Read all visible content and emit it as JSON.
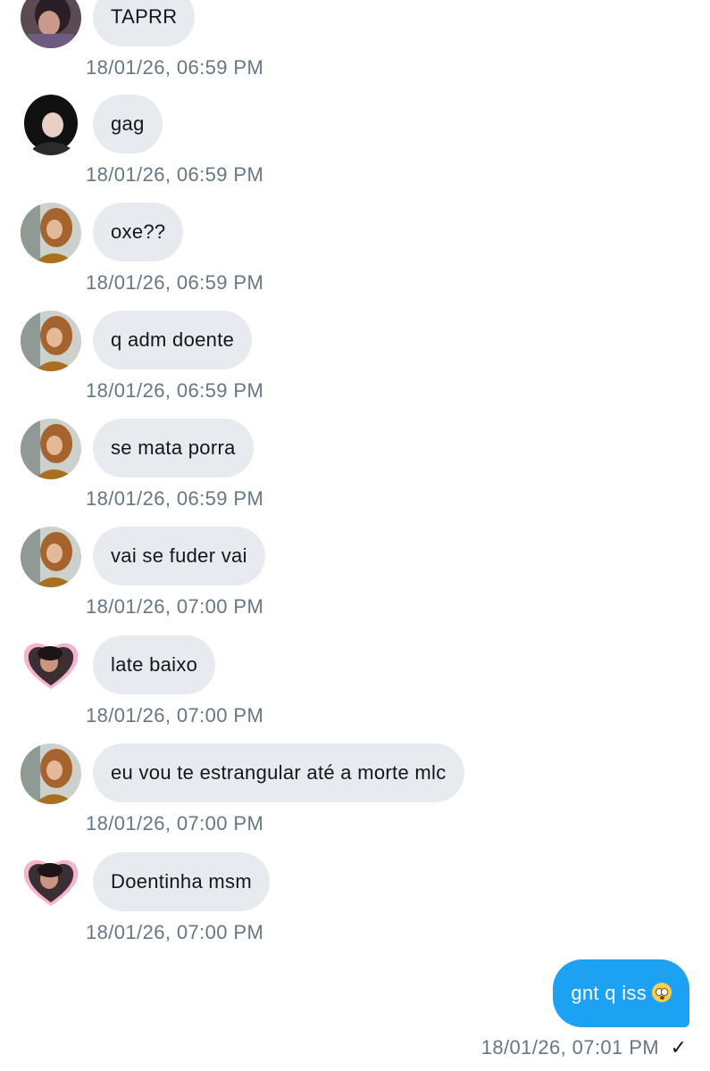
{
  "messages": [
    {
      "text": "TAPRR",
      "time": "18/01/26, 06:59 PM",
      "avatar": "avatar-b"
    },
    {
      "text": "gag",
      "time": "18/01/26, 06:59 PM",
      "avatar": "avatar-c"
    },
    {
      "text": "oxe??",
      "time": "18/01/26, 06:59 PM",
      "avatar": "avatar-a"
    },
    {
      "text": "q adm doente",
      "time": "18/01/26, 06:59 PM",
      "avatar": "avatar-a"
    },
    {
      "text": "se mata porra",
      "time": "18/01/26, 06:59 PM",
      "avatar": "avatar-a"
    },
    {
      "text": "vai se fuder vai",
      "time": "18/01/26, 07:00 PM",
      "avatar": "avatar-a"
    },
    {
      "text": "late baixo",
      "time": "18/01/26, 07:00 PM",
      "avatar": "avatar-heart"
    },
    {
      "text": "eu vou te estrangular até a morte mlc",
      "time": "18/01/26, 07:00 PM",
      "avatar": "avatar-a"
    },
    {
      "text": "Doentinha msm",
      "time": "18/01/26, 07:00 PM",
      "avatar": "avatar-heart"
    }
  ],
  "outgoing": {
    "text": "gnt q iss",
    "emoji": "flushed-face-emoji",
    "time": "18/01/26, 07:01 PM",
    "status": "✓"
  },
  "colors": {
    "incoming_bubble": "#e7ebef",
    "outgoing_bubble": "#1da1f2",
    "timestamp": "#657786",
    "text": "#14171a"
  }
}
